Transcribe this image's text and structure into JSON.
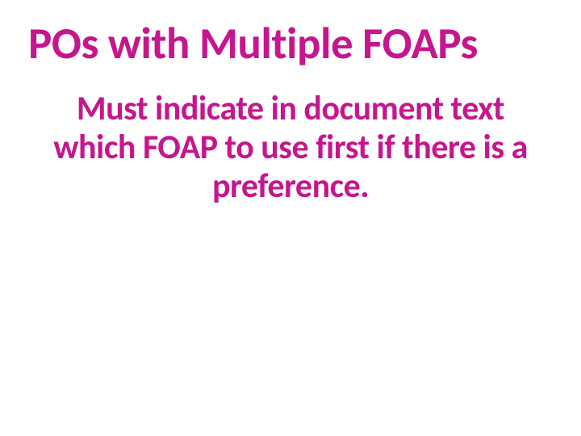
{
  "slide": {
    "title": "POs with Multiple FOAPs",
    "body": "Must indicate in document text which FOAP to use first if there is a preference."
  }
}
